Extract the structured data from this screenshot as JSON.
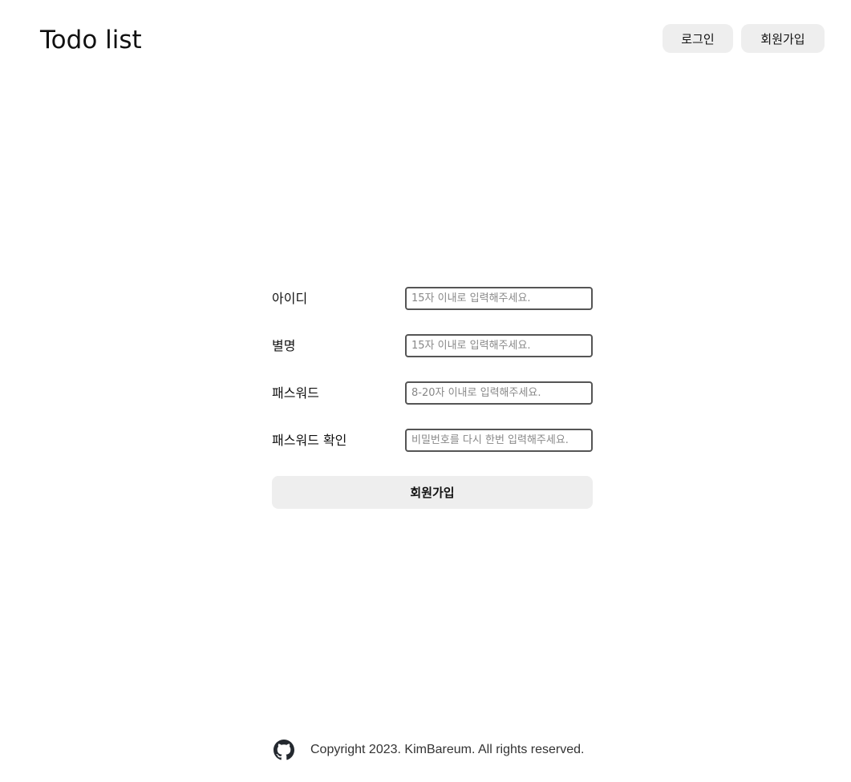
{
  "header": {
    "title": "Todo list",
    "login_label": "로그인",
    "signup_label": "회원가입"
  },
  "form": {
    "fields": [
      {
        "label": "아이디",
        "placeholder": "15자 이내로 입력해주세요.",
        "value": ""
      },
      {
        "label": "별명",
        "placeholder": "15자 이내로 입력해주세요.",
        "value": ""
      },
      {
        "label": "패스워드",
        "placeholder": "8-20자 이내로 입력해주세요.",
        "value": ""
      },
      {
        "label": "패스워드 확인",
        "placeholder": "비밀번호를 다시 한번 입력해주세요.",
        "value": ""
      }
    ],
    "submit_label": "회원가입"
  },
  "footer": {
    "icon": "github-icon",
    "copyright": "Copyright 2023. KimBareum. All rights reserved."
  },
  "colors": {
    "button_bg": "#eeeeee",
    "input_border": "#555555",
    "placeholder": "#888888"
  }
}
